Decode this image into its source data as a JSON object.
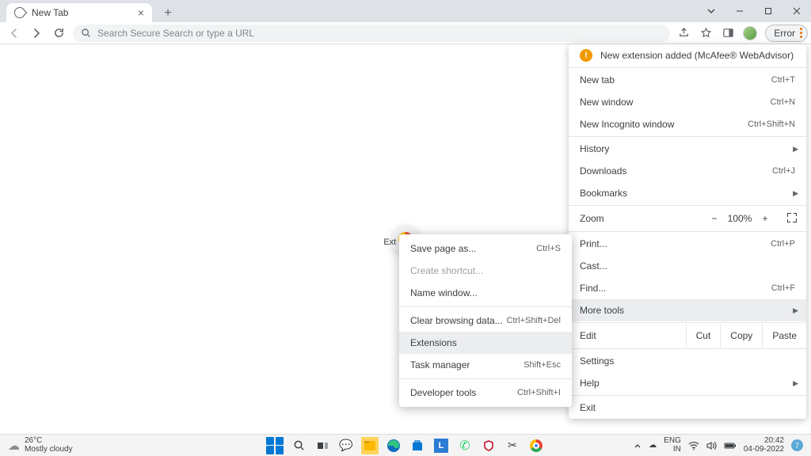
{
  "tab": {
    "title": "New Tab"
  },
  "omnibox": {
    "placeholder": "Search Secure Search or type a URL"
  },
  "error_pill": {
    "label": "Error"
  },
  "ntp": {
    "shortcut_label": "Ext"
  },
  "menu": {
    "alert": "New extension added (McAfee® WebAdvisor)",
    "new_tab": "New tab",
    "new_tab_sc": "Ctrl+T",
    "new_window": "New window",
    "new_window_sc": "Ctrl+N",
    "incognito": "New Incognito window",
    "incognito_sc": "Ctrl+Shift+N",
    "history": "History",
    "downloads": "Downloads",
    "downloads_sc": "Ctrl+J",
    "bookmarks": "Bookmarks",
    "zoom": "Zoom",
    "zoom_value": "100%",
    "print": "Print...",
    "print_sc": "Ctrl+P",
    "cast": "Cast...",
    "find": "Find...",
    "find_sc": "Ctrl+F",
    "more_tools": "More tools",
    "edit": "Edit",
    "cut": "Cut",
    "copy": "Copy",
    "paste": "Paste",
    "settings": "Settings",
    "help": "Help",
    "exit": "Exit"
  },
  "submenu": {
    "save_page": "Save page as...",
    "save_page_sc": "Ctrl+S",
    "create_shortcut": "Create shortcut...",
    "name_window": "Name window...",
    "clear_data": "Clear browsing data...",
    "clear_data_sc": "Ctrl+Shift+Del",
    "extensions": "Extensions",
    "task_manager": "Task manager",
    "task_manager_sc": "Shift+Esc",
    "dev_tools": "Developer tools",
    "dev_tools_sc": "Ctrl+Shift+I"
  },
  "taskbar": {
    "temp": "26°C",
    "weather": "Mostly cloudy",
    "lang1": "ENG",
    "lang2": "IN",
    "time": "20:42",
    "date": "04-09-2022",
    "notif_count": "7"
  }
}
